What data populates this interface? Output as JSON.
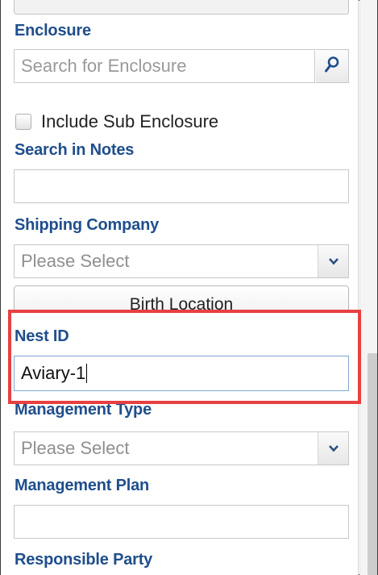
{
  "form": {
    "enclosure": {
      "label": "Enclosure",
      "placeholder": "Search for Enclosure",
      "search_icon": "magnifier-icon"
    },
    "include_sub_enclosure": {
      "label": "Include Sub Enclosure",
      "checked": false
    },
    "search_in_notes": {
      "label": "Search in Notes",
      "value": ""
    },
    "shipping_company": {
      "label": "Shipping Company",
      "selected": "Please Select"
    },
    "birth_location_button": {
      "label": "Birth Location"
    },
    "nest_id": {
      "label": "Nest ID",
      "value": "Aviary-1"
    },
    "management_type": {
      "label": "Management Type",
      "selected": "Please Select"
    },
    "management_plan": {
      "label": "Management Plan",
      "value": ""
    },
    "responsible_party": {
      "label": "Responsible Party"
    }
  },
  "colors": {
    "label_blue": "#1f4e8c",
    "highlight_red": "#e84040",
    "focus_border": "#7fa7d6"
  }
}
